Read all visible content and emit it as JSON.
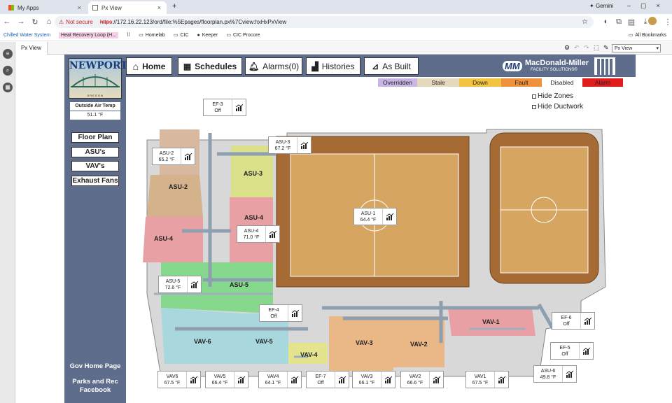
{
  "browser": {
    "tabs": [
      {
        "title": "My Apps"
      },
      {
        "title": "Px View"
      }
    ],
    "url_warning": "Not secure",
    "url_scheme": "https",
    "url_rest": "://172.16.22.123/ord/file:%5Epages/floorplan.px%7Cview:hxHxPxView",
    "gemini": "Gemini",
    "bookmarks": [
      {
        "label": "Chilled Water System"
      },
      {
        "label": "Heat Recovery Loop (H..."
      },
      {
        "label": "Homelab"
      },
      {
        "label": "CIC"
      },
      {
        "label": "Keeper"
      },
      {
        "label": "CIC Procore"
      },
      {
        "label": "All Bookmarks"
      }
    ]
  },
  "px": {
    "view_tab": "Px View",
    "view_select": "Px View"
  },
  "header": {
    "logo_text": "NEWPORT",
    "logo_sub": "OREGON",
    "buttons": [
      {
        "label": "Home",
        "icon": "home-icon"
      },
      {
        "label": "Schedules",
        "icon": "calendar-icon"
      },
      {
        "label": "Alarms(0)",
        "icon": "bell-icon"
      },
      {
        "label": "Histories",
        "icon": "chart-icon"
      },
      {
        "label": "As Built",
        "icon": "blueprint-icon"
      }
    ],
    "company_name": "MacDonald-Miller",
    "company_sub": "FACILITY SOLUTIONS®"
  },
  "legend": [
    {
      "label": "Overridden",
      "color": "#c9b6e4"
    },
    {
      "label": "Stale",
      "color": "#e5d9bd"
    },
    {
      "label": "Down",
      "color": "#f3c441"
    },
    {
      "label": "Fault",
      "color": "#f0923d"
    },
    {
      "label": "Disabled",
      "color": "#ffffff"
    },
    {
      "label": "Alarm",
      "color": "#e01c1c"
    }
  ],
  "checkboxes": [
    {
      "label": "Hide Zones"
    },
    {
      "label": "Hide Ductwork"
    }
  ],
  "sidebar": {
    "outside_air_label": "Outside Air Temp",
    "outside_air_value": "51.1 °F",
    "nav": [
      "Floor Plan",
      "ASU's",
      "VAV's",
      "Exhaust Fans"
    ],
    "gov_home": "Gov Home Page",
    "parks_rec": "Parks and Rec",
    "facebook": "Facebook"
  },
  "zones": [
    {
      "label": "ASU-2"
    },
    {
      "label": "ASU-3"
    },
    {
      "label": "ASU-4"
    },
    {
      "label": "ASU-4"
    },
    {
      "label": "ASU-5"
    },
    {
      "label": "VAV-6"
    },
    {
      "label": "VAV-5"
    },
    {
      "label": "VAV-4"
    },
    {
      "label": "VAV-3"
    },
    {
      "label": "VAV-2"
    },
    {
      "label": "VAV-1"
    }
  ],
  "points": [
    {
      "name": "EF-3",
      "value": "Off"
    },
    {
      "name": "ASU-2",
      "value": "65.2 °F"
    },
    {
      "name": "ASU-3",
      "value": "67.2 °F"
    },
    {
      "name": "ASU-1",
      "value": "64.4 °F"
    },
    {
      "name": "ASU-4",
      "value": "71.0 °F"
    },
    {
      "name": "ASU-5",
      "value": "72.6 °F"
    },
    {
      "name": "EF-4",
      "value": "Off"
    },
    {
      "name": "EF-6",
      "value": "Off"
    },
    {
      "name": "EF-5",
      "value": "Off"
    },
    {
      "name": "ASU-6",
      "value": "49.8 °F"
    },
    {
      "name": "VAV6",
      "value": "67.5 °F"
    },
    {
      "name": "VAV5",
      "value": "66.4 °F"
    },
    {
      "name": "VAV4",
      "value": "64.1 °F"
    },
    {
      "name": "EF-7",
      "value": "Off"
    },
    {
      "name": "VAV3",
      "value": "66.1 °F"
    },
    {
      "name": "VAV2",
      "value": "66.6 °F"
    },
    {
      "name": "VAV1",
      "value": "67.5 °F"
    }
  ]
}
